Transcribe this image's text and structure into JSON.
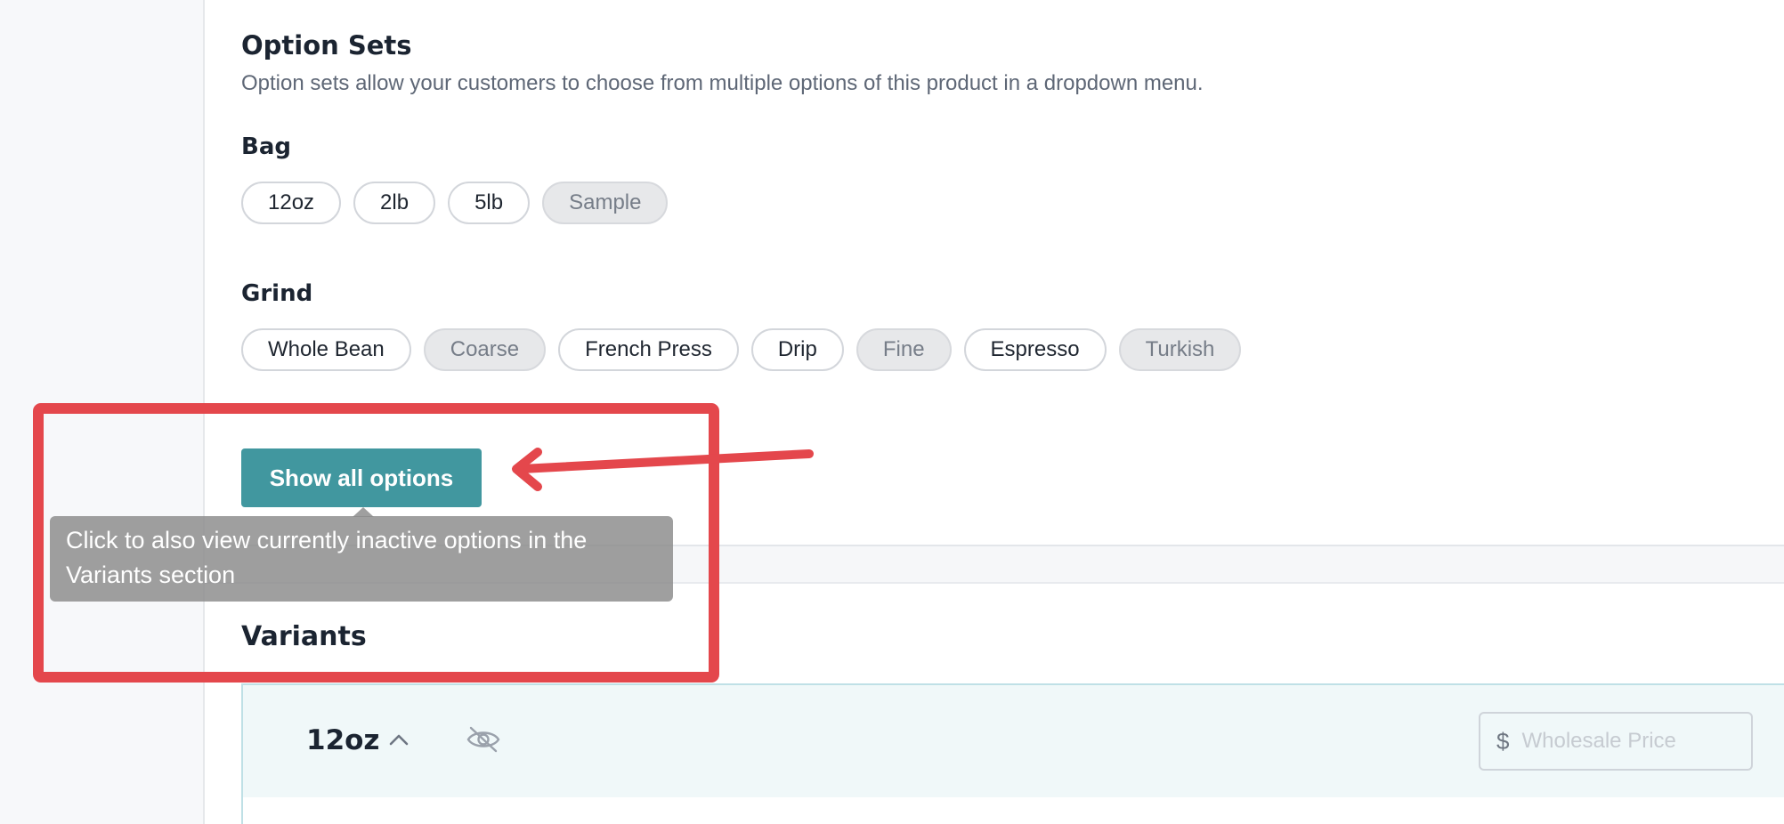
{
  "option_sets": {
    "title": "Option Sets",
    "description": "Option sets allow your customers to choose from multiple options of this product in a dropdown menu.",
    "groups": [
      {
        "label": "Bag",
        "options": [
          {
            "label": "12oz",
            "active": true
          },
          {
            "label": "2lb",
            "active": true
          },
          {
            "label": "5lb",
            "active": true
          },
          {
            "label": "Sample",
            "active": false
          }
        ]
      },
      {
        "label": "Grind",
        "options": [
          {
            "label": "Whole Bean",
            "active": true
          },
          {
            "label": "Coarse",
            "active": false
          },
          {
            "label": "French Press",
            "active": true
          },
          {
            "label": "Drip",
            "active": true
          },
          {
            "label": "Fine",
            "active": false
          },
          {
            "label": "Espresso",
            "active": true
          },
          {
            "label": "Turkish",
            "active": false
          }
        ]
      }
    ],
    "show_all_label": "Show all options",
    "tooltip": "Click to also view currently inactive options in the Variants section"
  },
  "variants": {
    "title": "Variants",
    "first": {
      "name": "12oz",
      "price_currency": "$",
      "price_placeholder": "Wholesale Price"
    }
  },
  "colors": {
    "accent": "#41979f",
    "annotation": "#e4474c",
    "inactive_chip": "#e7e8ea"
  },
  "icons": {
    "collapse": "chevron-up-icon",
    "visibility": "eye-off-icon"
  }
}
